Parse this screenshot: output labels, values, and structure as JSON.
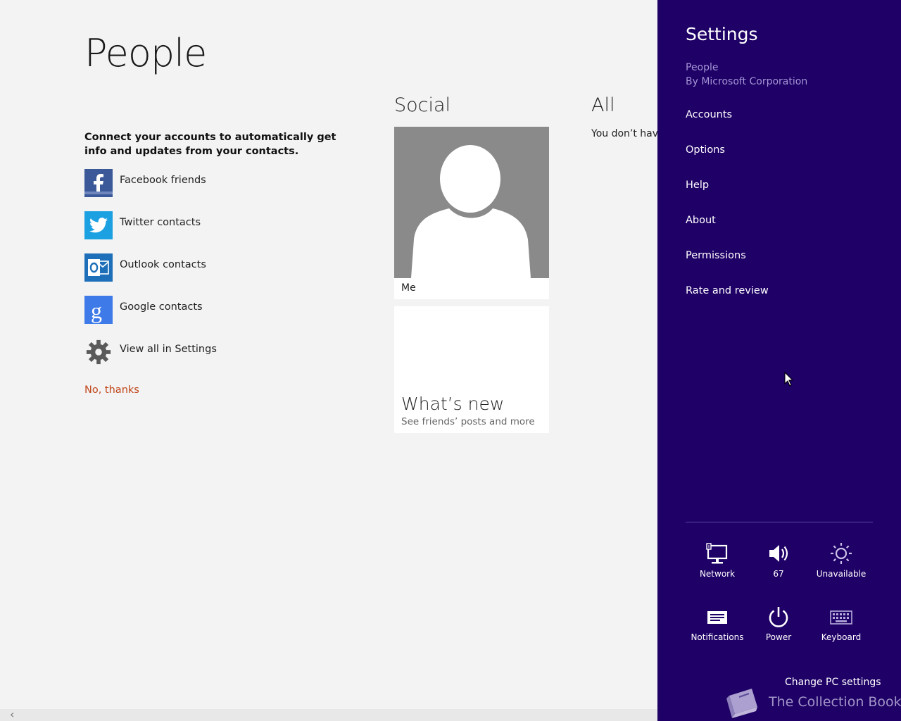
{
  "main": {
    "title": "People",
    "intro": "Connect your accounts to automatically get info and updates from your contacts.",
    "accounts": [
      {
        "label": "Facebook friends",
        "icon": "facebook-icon"
      },
      {
        "label": "Twitter contacts",
        "icon": "twitter-icon"
      },
      {
        "label": "Outlook contacts",
        "icon": "outlook-icon"
      },
      {
        "label": "Google contacts",
        "icon": "google-icon"
      },
      {
        "label": "View all in Settings",
        "icon": "gear-icon"
      }
    ],
    "no_thanks": "No, thanks",
    "social": {
      "heading": "Social",
      "me_label": "Me",
      "whats_new_title": "What’s new",
      "whats_new_sub": "See friends’ posts and more"
    },
    "all": {
      "heading": "All",
      "text": "You don’t have"
    }
  },
  "settings": {
    "title": "Settings",
    "app_name": "People",
    "app_publisher": "By Microsoft Corporation",
    "menu": [
      "Accounts",
      "Options",
      "Help",
      "About",
      "Permissions",
      "Rate and review"
    ],
    "quick": [
      {
        "label": "Network",
        "icon": "network-icon"
      },
      {
        "label": "67",
        "icon": "volume-icon"
      },
      {
        "label": "Unavailable",
        "icon": "brightness-icon"
      },
      {
        "label": "Notifications",
        "icon": "notifications-icon"
      },
      {
        "label": "Power",
        "icon": "power-icon"
      },
      {
        "label": "Keyboard",
        "icon": "keyboard-icon"
      }
    ],
    "change_pc": "Change PC settings",
    "watermark": "The Collection Book"
  },
  "colors": {
    "charm_bg": "#1e0066",
    "accent_link": "#c0461a"
  }
}
